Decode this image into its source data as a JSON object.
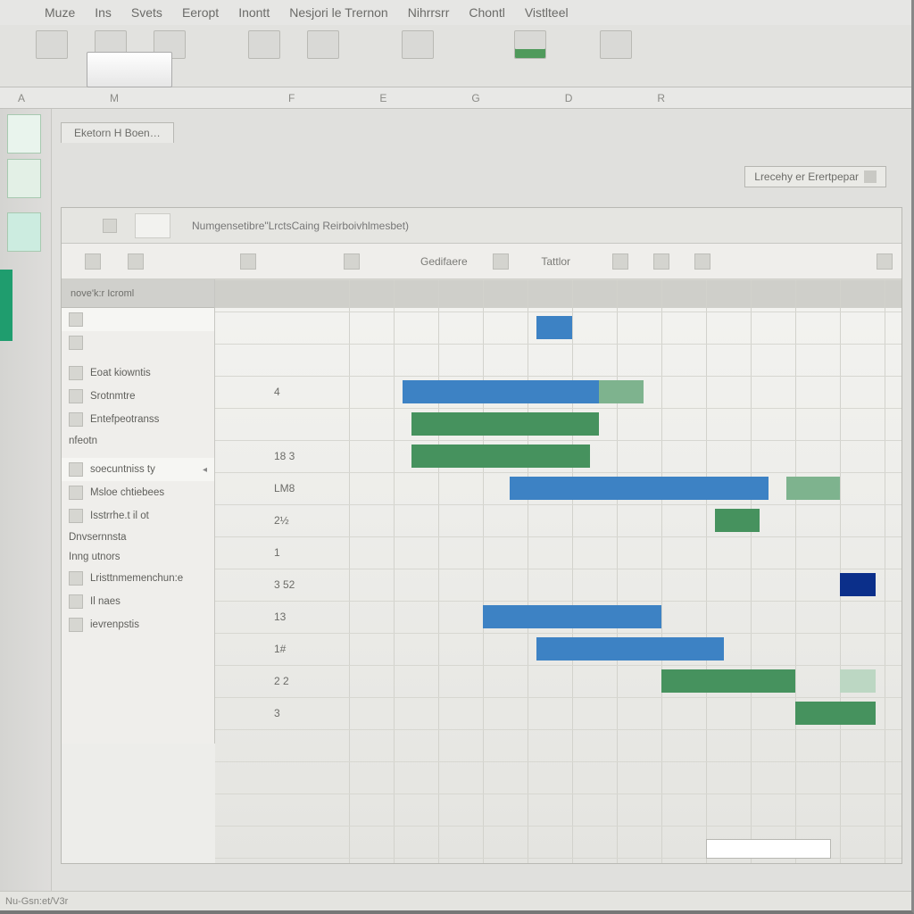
{
  "menubar": [
    "Muze",
    "Ins",
    "Svets",
    "Eeropt",
    "Inontt",
    "Nesjori le Trernon",
    "Nihrrsrr",
    "Chontl",
    "Vistlteel"
  ],
  "ribbon_labels": [
    "",
    "",
    "",
    "",
    "",
    "",
    ""
  ],
  "formula_row_letters": [
    "A",
    "M",
    "",
    "F",
    "E",
    "G",
    "D",
    "R"
  ],
  "tab_label": "Eketorn H Boen…",
  "right_button_label": "Lrecehy er Erertpepar",
  "sheet_title": "Numgensetibre\"LrctsCaing Reirboivhlmesbet)",
  "subbar_cols": [
    "Gedifaere",
    "Tattlor"
  ],
  "sidepanel_first": "nove'k:r Icroml",
  "sidepanel_items": [
    {
      "label": ""
    },
    {
      "label": ""
    },
    {
      "label": "Eoat kiowntis"
    },
    {
      "label": "Srotnmtre"
    },
    {
      "label": "Entefpeotranss"
    },
    {
      "label": "nfeotn"
    },
    {
      "label": "soecuntniss ty",
      "pin": "◂"
    },
    {
      "label": "Msloe chtiebees"
    },
    {
      "label": "Isstrrhe.t il ot"
    },
    {
      "label": "Dnvsernnsta"
    },
    {
      "label": "Inng utnors"
    },
    {
      "label": "Lristtnmemenchun:e"
    },
    {
      "label": "Il naes"
    },
    {
      "label": "ievrenpstis"
    }
  ],
  "row_numbers": [
    "",
    "",
    "",
    "4",
    "",
    "18 3",
    "LM8",
    "2½",
    "1",
    "3 52",
    "13",
    "1#",
    "2 2",
    "3"
  ],
  "status_text": "Nu-Gsn:et/V3r",
  "colors": {
    "blue": "#3d82c4",
    "green": "#46925e",
    "green_soft": "#7eb38e",
    "light_green": "#bcd7c3",
    "dark_blue": "#0b2f8a"
  },
  "chart_data": {
    "type": "bar",
    "orientation": "horizontal",
    "note": "Gantt-style; positions estimated from pixels, no axis labels visible",
    "bars": [
      {
        "row": 1,
        "series": "blue",
        "start": 360,
        "end": 400
      },
      {
        "row": 3,
        "series": "blue",
        "start": 210,
        "end": 430
      },
      {
        "row": 3,
        "series": "green_soft",
        "start": 430,
        "end": 480
      },
      {
        "row": 4,
        "series": "green",
        "start": 220,
        "end": 430
      },
      {
        "row": 5,
        "series": "green",
        "start": 220,
        "end": 420
      },
      {
        "row": 6,
        "series": "blue",
        "start": 330,
        "end": 620
      },
      {
        "row": 6,
        "series": "green_soft",
        "start": 640,
        "end": 700
      },
      {
        "row": 7,
        "series": "green",
        "start": 560,
        "end": 610
      },
      {
        "row": 9,
        "series": "dark_blue",
        "start": 700,
        "end": 740
      },
      {
        "row": 10,
        "series": "blue",
        "start": 300,
        "end": 500
      },
      {
        "row": 11,
        "series": "blue",
        "start": 360,
        "end": 570
      },
      {
        "row": 12,
        "series": "green",
        "start": 500,
        "end": 650
      },
      {
        "row": 12,
        "series": "light_green",
        "start": 700,
        "end": 740
      },
      {
        "row": 13,
        "series": "green",
        "start": 650,
        "end": 740
      }
    ]
  }
}
